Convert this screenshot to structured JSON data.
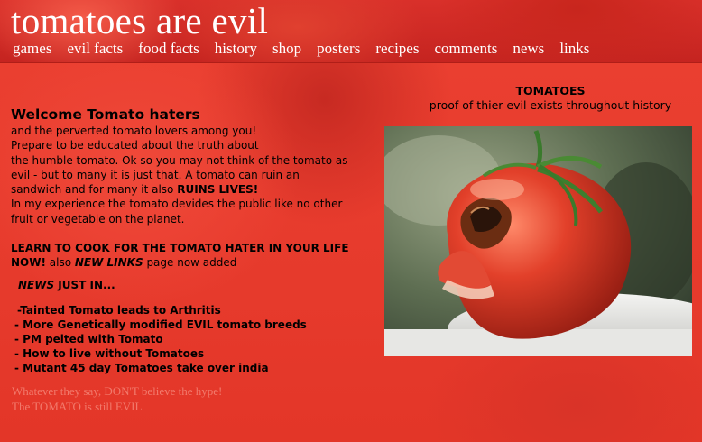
{
  "site": {
    "title": "tomatoes are evil"
  },
  "nav": [
    {
      "label": "games"
    },
    {
      "label": "evil facts"
    },
    {
      "label": "food facts"
    },
    {
      "label": "history"
    },
    {
      "label": "shop"
    },
    {
      "label": "posters"
    },
    {
      "label": "recipes"
    },
    {
      "label": "comments"
    },
    {
      "label": "news"
    },
    {
      "label": "links"
    }
  ],
  "intro": {
    "heading": "Welcome Tomato haters",
    "line1": "and the perverted tomato lovers among you!",
    "line2": "Prepare to be educated about the truth about",
    "line3": "the humble tomato. Ok so you may not think of the tomato as",
    "line4": "evil - but to many it is just that. A tomato can ruin an",
    "line5a": "sandwich and for many it also ",
    "line5b": "RUINS LIVES!",
    "line6": "In my experience the tomato devides the public like no other",
    "line7": "fruit or vegetable on the planet."
  },
  "cook": {
    "bold": "LEARN TO COOK FOR THE TOMATO HATER IN YOUR LIFE NOW!",
    "also": " also ",
    "new_links": "NEW LINKS",
    "rest": " page now added"
  },
  "news": {
    "label_italic": "NEWS",
    "label_rest": " JUST IN...",
    "items": [
      "-Tainted Tomato leads to Arthritis",
      "- More Genetically modified EVIL tomato breeds",
      "- PM pelted with Tomato",
      "- How to live without Tomatoes",
      "- Mutant 45 day Tomatoes take over india"
    ]
  },
  "tagline": {
    "line1": "Whatever they say, DON'T believe the hype!",
    "line2": "The TOMATO is still EVIL"
  },
  "feature": {
    "title": "TOMATOES",
    "subtitle": "proof of thier evil exists throughout history"
  },
  "colors": {
    "page_red": "#e8392b",
    "header_red": "#c52420",
    "faded_text": "#f27a6c"
  }
}
